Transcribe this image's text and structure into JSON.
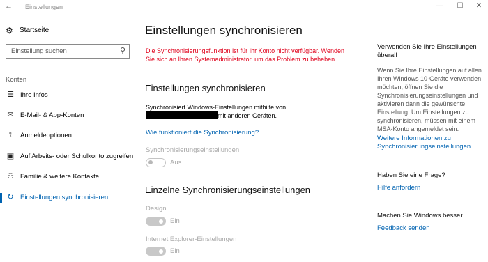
{
  "titlebar": {
    "title": "Einstellungen",
    "back_glyph": "←",
    "minimize_glyph": "—",
    "maximize_glyph": "☐",
    "close_glyph": "✕"
  },
  "sidebar": {
    "home_label": "Startseite",
    "home_icon": "gear-icon",
    "search_placeholder": "Einstellung suchen",
    "search_icon": "search-icon",
    "section_heading": "Konten",
    "items": [
      {
        "label": "Ihre Infos",
        "icon": "person-card-icon",
        "glyph": "☰",
        "active": false
      },
      {
        "label": "E-Mail- & App-Konten",
        "icon": "mail-icon",
        "glyph": "✉",
        "active": false
      },
      {
        "label": "Anmeldeoptionen",
        "icon": "key-icon",
        "glyph": "⚿",
        "active": false
      },
      {
        "label": "Auf Arbeits- oder Schulkonto zugreifen",
        "icon": "briefcase-icon",
        "glyph": "▣",
        "active": false
      },
      {
        "label": "Familie & weitere Kontakte",
        "icon": "person-icon",
        "glyph": "⚇",
        "active": false
      },
      {
        "label": "Einstellungen synchronisieren",
        "icon": "sync-icon",
        "glyph": "↻",
        "active": true
      }
    ],
    "accent": "#0063b1"
  },
  "main": {
    "title": "Einstellungen synchronisieren",
    "error_message": "Die Synchronisierungsfunktion ist für Ihr Konto nicht verfügbar. Wenden Sie sich an Ihren Systemadministrator, um das Problem zu beheben.",
    "error_color": "#e0001b",
    "section1_heading": "Einstellungen synchronisieren",
    "sync_text_line1": "Synchronisiert Windows-Einstellungen mithilfe von",
    "sync_text_suffix": "mit anderen Geräten.",
    "how_link": "Wie funktioniert die Synchronisierung?",
    "sync_settings_label": "Synchronisierungseinstellungen",
    "sync_settings_state": "Aus",
    "section2_heading": "Einzelne Synchronisierungseinstellungen",
    "design_label": "Design",
    "design_state": "Ein",
    "ie_label": "Internet Explorer-Einstellungen",
    "ie_state": "Ein"
  },
  "right": {
    "heading1": "Verwenden Sie Ihre Einstellungen überall",
    "paragraph": "Wenn Sie Ihre Einstellungen auf allen Ihren Windows 10-Geräte verwenden möchten, öffnen Sie die Synchronisierungseinstellungen und aktivieren dann die gewünschte Einstellung. Um Einstellungen zu synchronisieren, müssen mit einem MSA-Konto angemeldet sein.",
    "link1": "Weitere Informationen zu Synchronisierungseinstellungen",
    "heading2": "Haben Sie eine Frage?",
    "link2": "Hilfe anfordern",
    "heading3": "Machen Sie Windows besser.",
    "link3": "Feedback senden"
  }
}
